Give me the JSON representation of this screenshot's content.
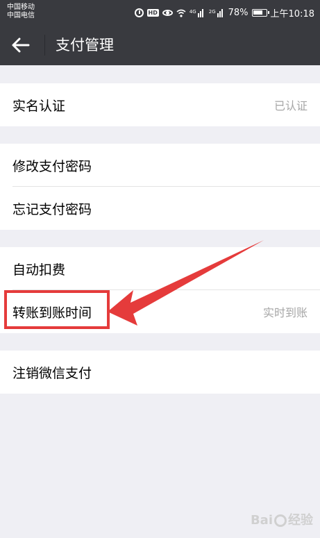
{
  "status_bar": {
    "carrier1": "中国移动",
    "carrier2": "中国电信",
    "net1": "4G",
    "net2": "2G",
    "battery": "78%",
    "time": "上午10:18"
  },
  "header": {
    "title": "支付管理"
  },
  "sections": [
    {
      "rows": [
        {
          "label": "实名认证",
          "value": "已认证"
        }
      ]
    },
    {
      "rows": [
        {
          "label": "修改支付密码"
        },
        {
          "label": "忘记支付密码"
        }
      ]
    },
    {
      "rows": [
        {
          "label": "自动扣费"
        },
        {
          "label": "转账到账时间",
          "value": "实时到账"
        }
      ]
    },
    {
      "rows": [
        {
          "label": "注销微信支付"
        }
      ]
    }
  ],
  "annotation": {
    "color": "#e53b3b"
  },
  "watermark": {
    "brand": "Bai",
    "brand2": "经验"
  }
}
